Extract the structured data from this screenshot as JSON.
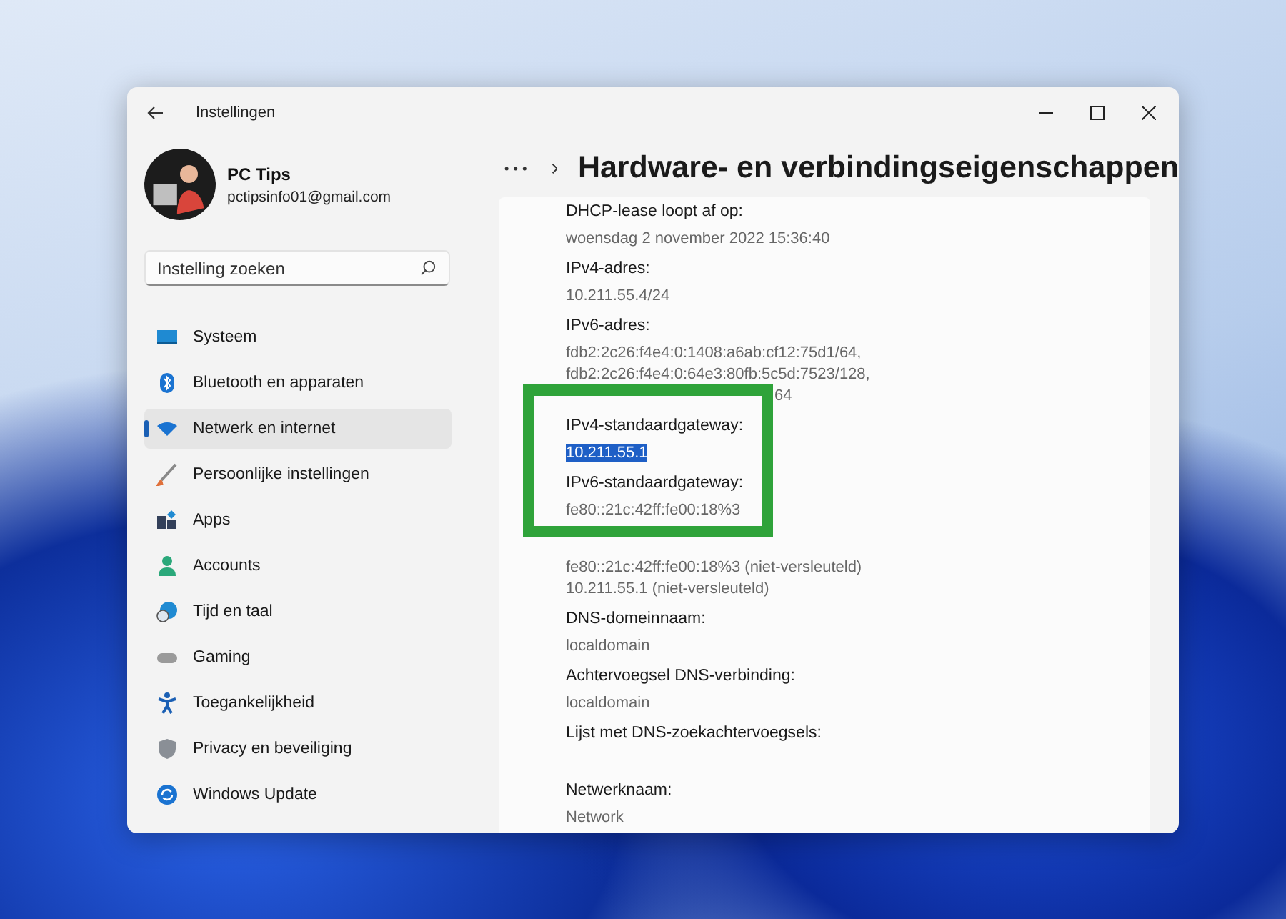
{
  "window": {
    "title": "Instellingen"
  },
  "profile": {
    "name": "PC Tips",
    "email": "pctipsinfo01@gmail.com"
  },
  "search": {
    "placeholder": "Instelling zoeken"
  },
  "sidebar": {
    "items": [
      {
        "label": "Systeem",
        "selected": false
      },
      {
        "label": "Bluetooth en apparaten",
        "selected": false
      },
      {
        "label": "Netwerk en internet",
        "selected": true
      },
      {
        "label": "Persoonlijke instellingen",
        "selected": false
      },
      {
        "label": "Apps",
        "selected": false
      },
      {
        "label": "Accounts",
        "selected": false
      },
      {
        "label": "Tijd en taal",
        "selected": false
      },
      {
        "label": "Gaming",
        "selected": false
      },
      {
        "label": "Toegankelijkheid",
        "selected": false
      },
      {
        "label": "Privacy en beveiliging",
        "selected": false
      },
      {
        "label": "Windows Update",
        "selected": false
      }
    ]
  },
  "page": {
    "title": "Hardware- en verbindingseigenschappen"
  },
  "properties": [
    {
      "label": "DHCP-lease loopt af op:",
      "values": [
        {
          "text": "woensdag 2 november 2022 15:36:40",
          "selected": false,
          "covered": false
        }
      ]
    },
    {
      "label": "IPv4-adres:",
      "values": [
        {
          "text": "10.211.55.4/24",
          "selected": false,
          "covered": false
        }
      ]
    },
    {
      "label": "IPv6-adres:",
      "values": [
        {
          "text": "fdb2:2c26:f4e4:0:1408:a6ab:cf12:75d1/64,",
          "selected": false,
          "covered": false
        },
        {
          "text": "fdb2:2c26:f4e4:0:64e3:80fb:5c5d:7523/128,",
          "selected": false,
          "covered": false
        },
        {
          "text": "64",
          "selected": false,
          "covered": true
        }
      ]
    },
    {
      "label": "IPv4-standaardgateway:",
      "values": [
        {
          "text": "10.211.55.1",
          "selected": true,
          "covered": false
        }
      ]
    },
    {
      "label": "IPv6-standaardgateway:",
      "values": [
        {
          "text": "fe80::21c:42ff:fe00:18%3",
          "selected": false,
          "covered": false
        }
      ]
    },
    {
      "values": [
        {
          "text": "fe80::21c:42ff:fe00:18%3 (niet-versleuteld)",
          "selected": false,
          "covered": false
        },
        {
          "text": "10.211.55.1 (niet-versleuteld)",
          "selected": false,
          "covered": false
        }
      ]
    },
    {
      "label": "DNS-domeinnaam:",
      "values": [
        {
          "text": "localdomain",
          "selected": false,
          "covered": false
        }
      ]
    },
    {
      "label": "Achtervoegsel DNS-verbinding:",
      "values": [
        {
          "text": "localdomain",
          "selected": false,
          "covered": false
        }
      ]
    },
    {
      "label": "Lijst met DNS-zoekachtervoegsels:"
    },
    {
      "label": "Netwerknaam:",
      "values": [
        {
          "text": "Network",
          "selected": false,
          "covered": false
        }
      ]
    }
  ]
}
